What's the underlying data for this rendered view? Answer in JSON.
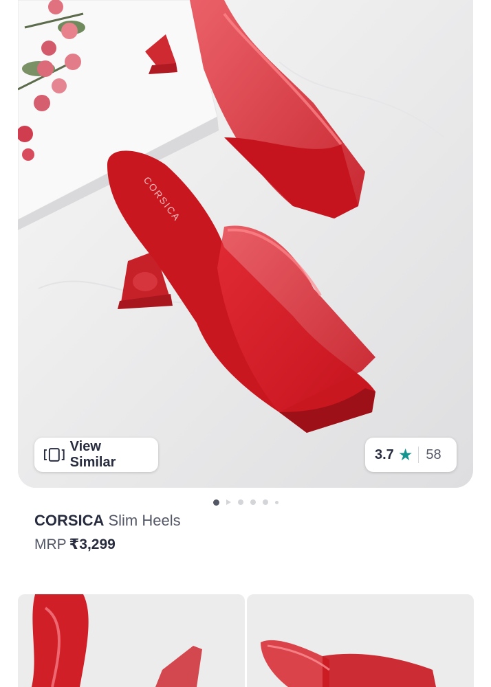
{
  "product": {
    "brand": "CORSICA",
    "name": "Slim Heels",
    "mrp_label": "MRP",
    "price": "₹3,299",
    "sole_print": "CORSICA"
  },
  "actions": {
    "view_similar_label": "View Similar"
  },
  "rating": {
    "score": "3.7",
    "count": "58"
  },
  "carousel": {
    "total_indicators": 6,
    "active_index": 0
  },
  "colors": {
    "accent_star": "#14958f",
    "shoe_red": "#d8222a"
  }
}
